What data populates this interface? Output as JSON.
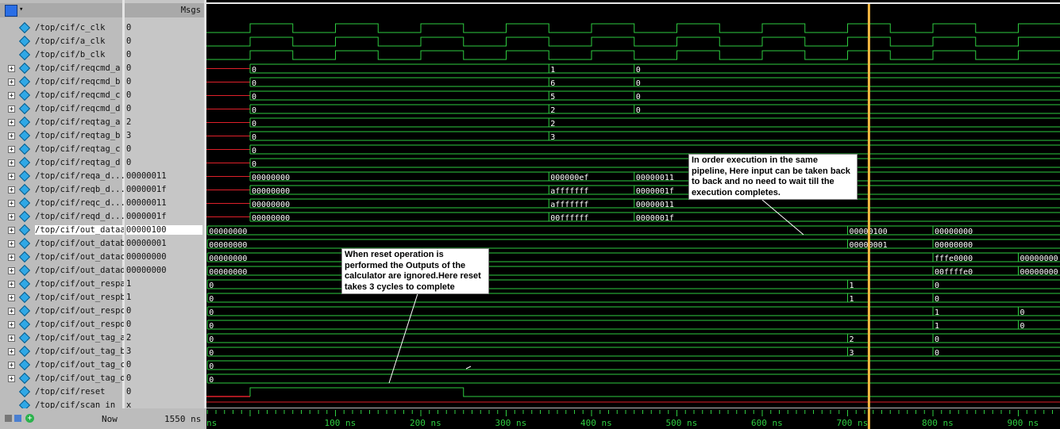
{
  "toolbar": {
    "msgs_label": "Msgs"
  },
  "signals": [
    {
      "name": "/top/cif/c_clk",
      "value": "0",
      "expandable": false
    },
    {
      "name": "/top/cif/a_clk",
      "value": "0",
      "expandable": false
    },
    {
      "name": "/top/cif/b_clk",
      "value": "0",
      "expandable": false
    },
    {
      "name": "/top/cif/reqcmd_a",
      "value": "0",
      "expandable": true
    },
    {
      "name": "/top/cif/reqcmd_b",
      "value": "0",
      "expandable": true
    },
    {
      "name": "/top/cif/reqcmd_c",
      "value": "0",
      "expandable": true
    },
    {
      "name": "/top/cif/reqcmd_d",
      "value": "0",
      "expandable": true
    },
    {
      "name": "/top/cif/reqtag_a",
      "value": "2",
      "expandable": true
    },
    {
      "name": "/top/cif/reqtag_b",
      "value": "3",
      "expandable": true
    },
    {
      "name": "/top/cif/reqtag_c",
      "value": "0",
      "expandable": true
    },
    {
      "name": "/top/cif/reqtag_d",
      "value": "0",
      "expandable": true
    },
    {
      "name": "/top/cif/reqa_d...",
      "value": "00000011",
      "expandable": true
    },
    {
      "name": "/top/cif/reqb_d...",
      "value": "0000001f",
      "expandable": true
    },
    {
      "name": "/top/cif/reqc_d...",
      "value": "00000011",
      "expandable": true
    },
    {
      "name": "/top/cif/reqd_d...",
      "value": "0000001f",
      "expandable": true
    },
    {
      "name": "/top/cif/out_dataa",
      "value": "00000100",
      "expandable": true,
      "selected": true
    },
    {
      "name": "/top/cif/out_datab",
      "value": "00000001",
      "expandable": true
    },
    {
      "name": "/top/cif/out_datac",
      "value": "00000000",
      "expandable": true
    },
    {
      "name": "/top/cif/out_datad",
      "value": "00000000",
      "expandable": true
    },
    {
      "name": "/top/cif/out_respa",
      "value": "1",
      "expandable": true
    },
    {
      "name": "/top/cif/out_respb",
      "value": "1",
      "expandable": true
    },
    {
      "name": "/top/cif/out_respc",
      "value": "0",
      "expandable": true
    },
    {
      "name": "/top/cif/out_respd",
      "value": "0",
      "expandable": true
    },
    {
      "name": "/top/cif/out_tag_a",
      "value": "2",
      "expandable": true
    },
    {
      "name": "/top/cif/out_tag_b",
      "value": "3",
      "expandable": true
    },
    {
      "name": "/top/cif/out_tag_c",
      "value": "0",
      "expandable": true
    },
    {
      "name": "/top/cif/out_tag_d",
      "value": "0",
      "expandable": true
    },
    {
      "name": "/top/cif/reset",
      "value": "0",
      "expandable": false
    },
    {
      "name": "/top/cif/scan_in",
      "value": "x",
      "expandable": false
    }
  ],
  "bus_labels": [
    {
      "row": 3,
      "items": [
        [
          0,
          "0"
        ],
        [
          350,
          "1"
        ],
        [
          450,
          "0"
        ]
      ]
    },
    {
      "row": 4,
      "items": [
        [
          0,
          "0"
        ],
        [
          350,
          "6"
        ],
        [
          450,
          "0"
        ]
      ]
    },
    {
      "row": 5,
      "items": [
        [
          0,
          "0"
        ],
        [
          350,
          "5"
        ],
        [
          450,
          "0"
        ]
      ]
    },
    {
      "row": 6,
      "items": [
        [
          0,
          "0"
        ],
        [
          350,
          "2"
        ],
        [
          450,
          "0"
        ]
      ]
    },
    {
      "row": 7,
      "items": [
        [
          0,
          "0"
        ],
        [
          350,
          "2"
        ]
      ]
    },
    {
      "row": 8,
      "items": [
        [
          0,
          "0"
        ],
        [
          350,
          "3"
        ]
      ]
    },
    {
      "row": 9,
      "items": [
        [
          0,
          "0"
        ]
      ]
    },
    {
      "row": 10,
      "items": [
        [
          0,
          "0"
        ]
      ]
    },
    {
      "row": 11,
      "items": [
        [
          0,
          "00000000"
        ],
        [
          350,
          "000000ef"
        ],
        [
          450,
          "00000011"
        ]
      ]
    },
    {
      "row": 12,
      "items": [
        [
          0,
          "00000000"
        ],
        [
          350,
          "afffffff"
        ],
        [
          450,
          "0000001f"
        ]
      ]
    },
    {
      "row": 13,
      "items": [
        [
          0,
          "00000000"
        ],
        [
          350,
          "afffffff"
        ],
        [
          450,
          "00000011"
        ]
      ]
    },
    {
      "row": 14,
      "items": [
        [
          0,
          "00000000"
        ],
        [
          350,
          "00ffffff"
        ],
        [
          450,
          "0000001f"
        ]
      ]
    },
    {
      "row": 15,
      "items": [
        [
          -50,
          "00000000"
        ],
        [
          700,
          "00000100"
        ],
        [
          800,
          "00000000"
        ]
      ]
    },
    {
      "row": 16,
      "items": [
        [
          -50,
          "00000000"
        ],
        [
          700,
          "00000001"
        ],
        [
          800,
          "00000000"
        ]
      ]
    },
    {
      "row": 17,
      "items": [
        [
          -50,
          "00000000"
        ],
        [
          800,
          "fffe0000"
        ],
        [
          900,
          "00000000"
        ]
      ]
    },
    {
      "row": 18,
      "items": [
        [
          -50,
          "00000000"
        ],
        [
          800,
          "00ffffe0"
        ],
        [
          900,
          "00000000"
        ]
      ]
    },
    {
      "row": 19,
      "items": [
        [
          -50,
          "0"
        ],
        [
          700,
          "1"
        ],
        [
          800,
          "0"
        ]
      ]
    },
    {
      "row": 20,
      "items": [
        [
          -50,
          "0"
        ],
        [
          700,
          "1"
        ],
        [
          800,
          "0"
        ]
      ]
    },
    {
      "row": 21,
      "items": [
        [
          -50,
          "0"
        ],
        [
          800,
          "1"
        ],
        [
          900,
          "0"
        ]
      ]
    },
    {
      "row": 22,
      "items": [
        [
          -50,
          "0"
        ],
        [
          800,
          "1"
        ],
        [
          900,
          "0"
        ]
      ]
    },
    {
      "row": 23,
      "items": [
        [
          -50,
          "0"
        ],
        [
          700,
          "2"
        ],
        [
          800,
          "0"
        ]
      ]
    },
    {
      "row": 24,
      "items": [
        [
          -50,
          "0"
        ],
        [
          700,
          "3"
        ],
        [
          800,
          "0"
        ]
      ]
    },
    {
      "row": 25,
      "items": [
        [
          -50,
          "0"
        ]
      ]
    },
    {
      "row": 26,
      "items": [
        [
          -50,
          "0"
        ]
      ]
    }
  ],
  "timeline": {
    "now_label": "Now",
    "now_value": "1550 ns",
    "cursor_ns": 725,
    "ticks": [
      "ns",
      "100 ns",
      "200 ns",
      "300 ns",
      "400 ns",
      "500 ns",
      "600 ns",
      "700 ns",
      "800 ns",
      "900 ns",
      "100"
    ]
  },
  "annotations": {
    "reset_note": [
      "When reset operation is",
      "performed the Outputs of the",
      "calculator are ignored.Here reset",
      "takes 3 cycles to complete"
    ],
    "pipeline_note": [
      "In order execution in the same",
      "pipeline, Here input can be taken back",
      "to back and no need to wait till the",
      "execution completes."
    ]
  },
  "colors": {
    "wave_green": "#2ecc40",
    "cursor_yellow": "#f5b942",
    "reset_red": "#e0202a",
    "panel_gray": "#bcbcbc"
  }
}
